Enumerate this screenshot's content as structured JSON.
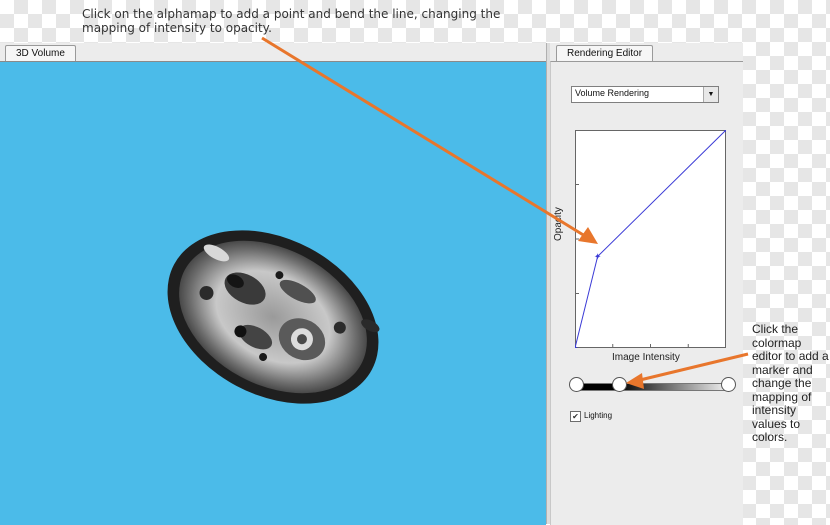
{
  "annotations": {
    "top_note": "Click on the alphamap to add a point and bend the line, changing the mapping of intensity to opacity.",
    "side_note": "Click the colormap editor to add a marker and change the mapping of intensity values to colors.",
    "arrow_color": "#e8762c"
  },
  "left_panel": {
    "tab_label": "3D Volume",
    "background_color": "#4bbbe9"
  },
  "right_panel": {
    "tab_label": "Rendering Editor",
    "rendering_mode": {
      "selected": "Volume Rendering"
    },
    "alphamap": {
      "y_label": "Opacity",
      "x_label": "Image Intensity",
      "curve_color": "#3b3bd6",
      "control_points": [
        {
          "intensity": 0.0,
          "opacity": 0.0
        },
        {
          "intensity": 0.15,
          "opacity": 0.42
        },
        {
          "intensity": 1.0,
          "opacity": 1.0
        }
      ]
    },
    "colormap": {
      "markers": [
        0.0,
        0.28,
        1.0
      ]
    },
    "lighting": {
      "label": "Lighting",
      "checked": true
    }
  }
}
